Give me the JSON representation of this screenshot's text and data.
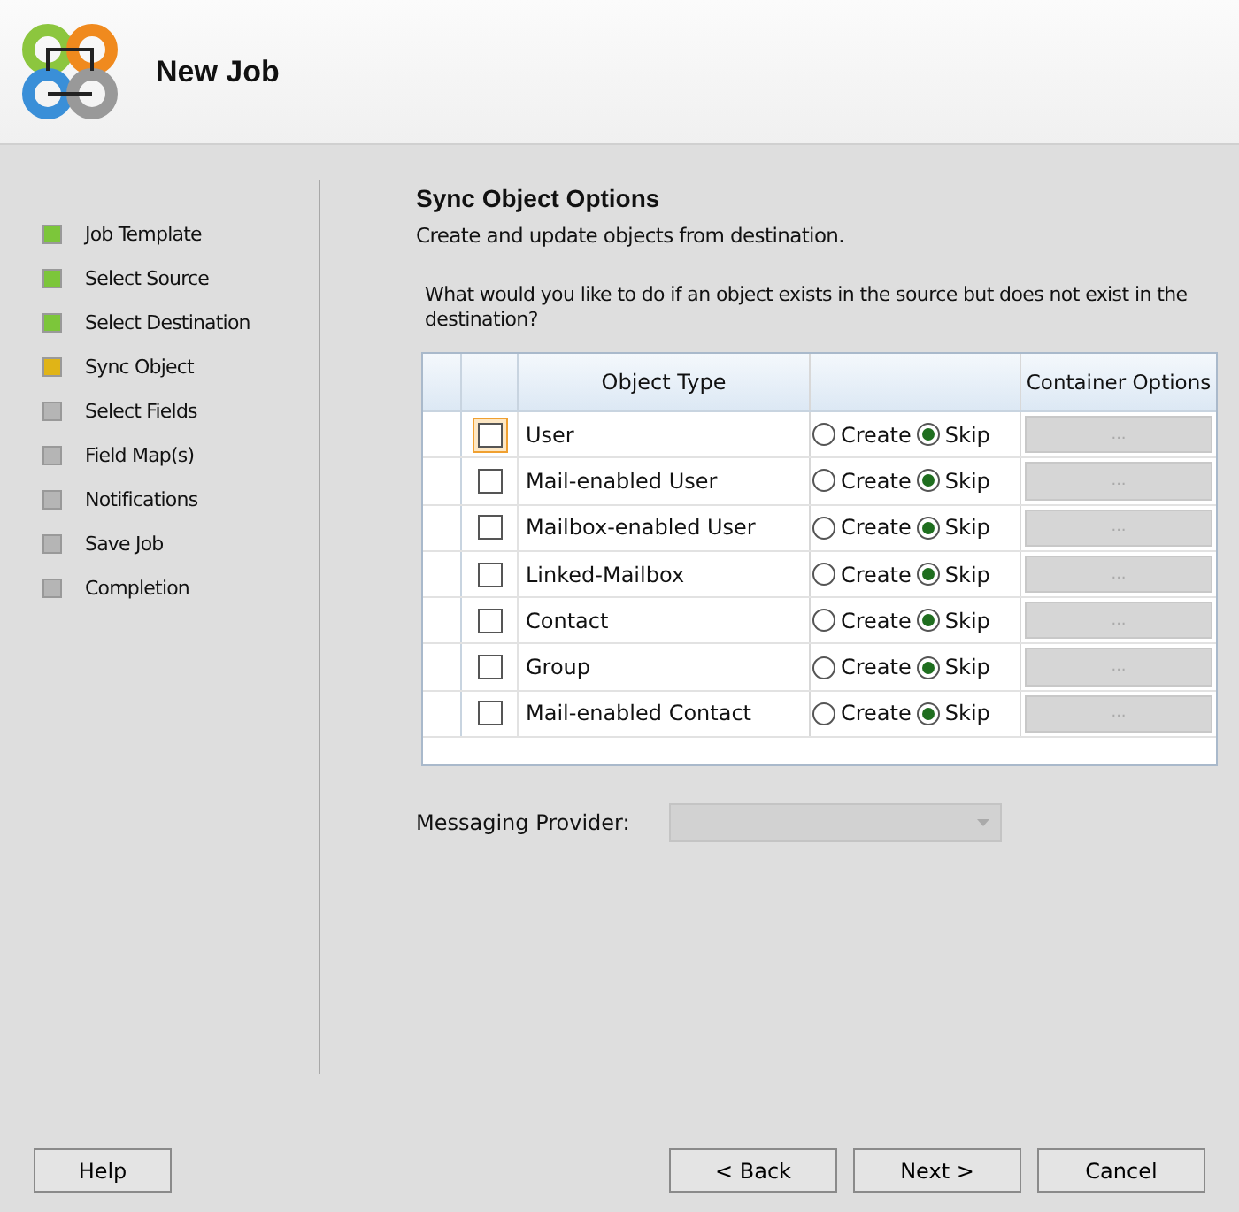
{
  "window": {
    "title": "New Job"
  },
  "steps": [
    {
      "label": "Job Template",
      "color": "#7cc63a"
    },
    {
      "label": "Select Source",
      "color": "#7cc63a"
    },
    {
      "label": "Select Destination",
      "color": "#7cc63a"
    },
    {
      "label": "Sync Object",
      "color": "#e0b417"
    },
    {
      "label": "Select Fields",
      "color": "#b5b5b5"
    },
    {
      "label": "Field Map(s)",
      "color": "#b5b5b5"
    },
    {
      "label": "Notifications",
      "color": "#b5b5b5"
    },
    {
      "label": "Save Job",
      "color": "#b5b5b5"
    },
    {
      "label": "Completion",
      "color": "#b5b5b5"
    }
  ],
  "page": {
    "title": "Sync Object Options",
    "subtitle": "Create and update objects from destination.",
    "question": "What would you like to do if an object exists in the source but does not exist in the destination?"
  },
  "table": {
    "columns": [
      "Object Type",
      "Container Options"
    ],
    "rows": [
      {
        "object_type": "User",
        "checked": false,
        "focused": true,
        "options": [
          {
            "label": "Create",
            "selected": false
          },
          {
            "label": "Skip",
            "selected": true
          }
        ],
        "container_button": "...",
        "disabled": true
      },
      {
        "object_type": "Mail-enabled User",
        "checked": false,
        "focused": false,
        "options": [
          {
            "label": "Create",
            "selected": false
          },
          {
            "label": "Skip",
            "selected": true
          }
        ],
        "container_button": "...",
        "disabled": true
      },
      {
        "object_type": "Mailbox-enabled User",
        "checked": false,
        "focused": false,
        "options": [
          {
            "label": "Create",
            "selected": false
          },
          {
            "label": "Skip",
            "selected": true
          }
        ],
        "container_button": "...",
        "disabled": true
      },
      {
        "object_type": "Linked-Mailbox",
        "checked": false,
        "focused": false,
        "options": [
          {
            "label": "Create",
            "selected": false
          },
          {
            "label": "Skip",
            "selected": true
          }
        ],
        "container_button": "...",
        "disabled": true
      },
      {
        "object_type": "Contact",
        "checked": false,
        "focused": false,
        "options": [
          {
            "label": "Create",
            "selected": false
          },
          {
            "label": "Skip",
            "selected": true
          }
        ],
        "container_button": "...",
        "disabled": true
      },
      {
        "object_type": "Group",
        "checked": false,
        "focused": false,
        "options": [
          {
            "label": "Create",
            "selected": false
          },
          {
            "label": "Skip",
            "selected": true
          }
        ],
        "container_button": "...",
        "disabled": true
      },
      {
        "object_type": "Mail-enabled Contact",
        "checked": false,
        "focused": false,
        "options": [
          {
            "label": "Create",
            "selected": false
          },
          {
            "label": "Skip",
            "selected": true
          }
        ],
        "container_button": "...",
        "disabled": true
      }
    ]
  },
  "messaging_provider": {
    "label": "Messaging Provider:",
    "disabled": true
  },
  "buttons": {
    "left": [
      "Help"
    ],
    "right": [
      "< Back",
      "Next >",
      "Cancel"
    ]
  }
}
